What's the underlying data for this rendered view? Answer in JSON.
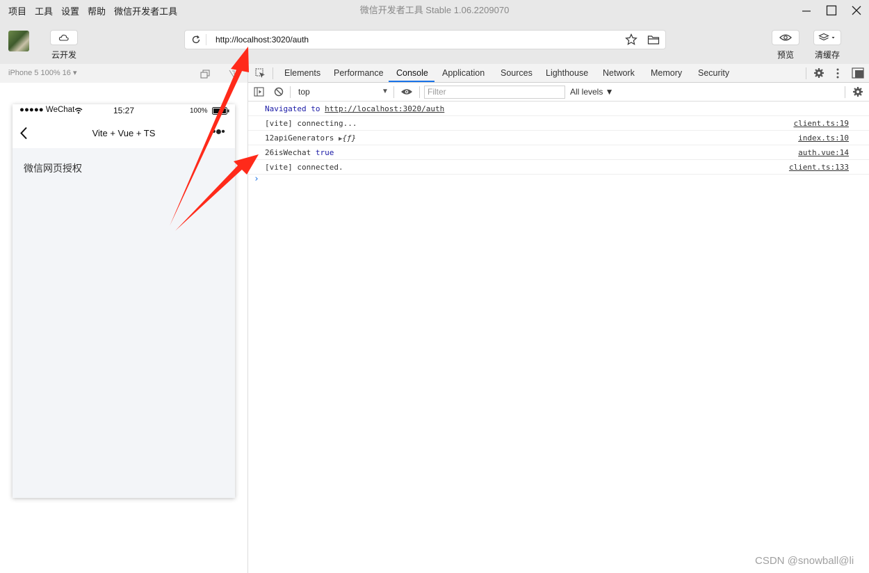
{
  "menu": [
    "项目",
    "工具",
    "设置",
    "帮助",
    "微信开发者工具"
  ],
  "window_title": "微信开发者工具 Stable 1.06.2209070",
  "toolbar": {
    "cloud_label": "云开发",
    "preview_label": "预览",
    "clear_cache_label": "清缓存"
  },
  "url": "http://localhost:3020/auth",
  "simulator": {
    "device": "iPhone 5 100% 16 ▾",
    "status": {
      "signal": "●●●●● WeChat",
      "time": "15:27",
      "battery": "100%"
    },
    "nav_title": "Vite + Vue + TS",
    "nav_more": "•●•",
    "page_text": "微信网页授权"
  },
  "devtools": {
    "tabs": [
      "Elements",
      "Performance",
      "Console",
      "Application",
      "Sources",
      "Lighthouse",
      "Network",
      "Memory",
      "Security"
    ],
    "active_tab": "Console"
  },
  "console_toolbar": {
    "context": "top",
    "filter_placeholder": "Filter",
    "levels": "All levels ▼"
  },
  "messages": {
    "m0": {
      "prefix": "Navigated to ",
      "link": "http://localhost:3020/auth"
    },
    "m1": {
      "text": "[vite] connecting...",
      "source": "client.ts:19"
    },
    "m2": {
      "text": "12apiGenerators ",
      "tri": "▶",
      "value": "{ƒ}",
      "source": "index.ts:10"
    },
    "m3": {
      "text": "26isWechat ",
      "value": "true",
      "source": "auth.vue:14"
    },
    "m4": {
      "text": "[vite] connected.",
      "source": "client.ts:133"
    }
  },
  "watermark": "CSDN @snowball@li",
  "colors": {
    "accent": "#1a73e8",
    "arrow": "#ff2a1a",
    "chrome_bg": "#e8e8e8"
  }
}
